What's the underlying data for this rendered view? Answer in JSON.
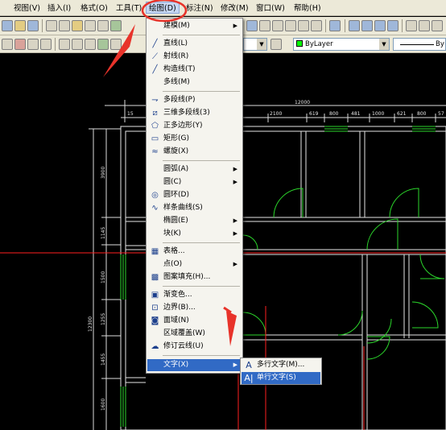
{
  "menubar": {
    "items": [
      {
        "label": "视图(V)"
      },
      {
        "label": "插入(I)"
      },
      {
        "label": "格式(O)"
      },
      {
        "label": "工具(T)"
      },
      {
        "label": "绘图(D)"
      },
      {
        "label": "标注(N)"
      },
      {
        "label": "修改(M)"
      },
      {
        "label": "窗口(W)"
      },
      {
        "label": "帮助(H)"
      }
    ],
    "active_index": 4
  },
  "toolbar": {
    "layer_color_combo": "ByLayer",
    "linetype_combo": "By"
  },
  "draw_menu": {
    "items": [
      {
        "icon": "",
        "label": "建模(M)",
        "submenu": true
      },
      {
        "icon": "line-icon",
        "label": "直线(L)",
        "submenu": false
      },
      {
        "icon": "ray-icon",
        "label": "射线(R)",
        "submenu": false
      },
      {
        "icon": "construction-line-icon",
        "label": "构造线(T)",
        "submenu": false
      },
      {
        "icon": "",
        "label": "多线(M)",
        "submenu": false
      },
      {
        "icon": "polyline-icon",
        "label": "多段线(P)",
        "submenu": false
      },
      {
        "icon": "3d-polyline-icon",
        "label": "三维多段线(3)",
        "submenu": false
      },
      {
        "icon": "polygon-icon",
        "label": "正多边形(Y)",
        "submenu": false
      },
      {
        "icon": "rectangle-icon",
        "label": "矩形(G)",
        "submenu": false
      },
      {
        "icon": "helix-icon",
        "label": "螺旋(X)",
        "submenu": false
      },
      {
        "icon": "",
        "label": "圆弧(A)",
        "submenu": true
      },
      {
        "icon": "",
        "label": "圆(C)",
        "submenu": true
      },
      {
        "icon": "donut-icon",
        "label": "圆环(D)",
        "submenu": false
      },
      {
        "icon": "spline-icon",
        "label": "样条曲线(S)",
        "submenu": false
      },
      {
        "icon": "",
        "label": "椭圆(E)",
        "submenu": true
      },
      {
        "icon": "",
        "label": "块(K)",
        "submenu": true
      },
      {
        "icon": "table-icon",
        "label": "表格...",
        "submenu": false
      },
      {
        "icon": "",
        "label": "点(O)",
        "submenu": true
      },
      {
        "icon": "hatch-icon",
        "label": "图案填充(H)...",
        "submenu": false
      },
      {
        "icon": "gradient-icon",
        "label": "渐变色...",
        "submenu": false
      },
      {
        "icon": "boundary-icon",
        "label": "边界(B)...",
        "submenu": false
      },
      {
        "icon": "region-icon",
        "label": "面域(N)",
        "submenu": false
      },
      {
        "icon": "",
        "label": "区域覆盖(W)",
        "submenu": false
      },
      {
        "icon": "revcloud-icon",
        "label": "修订云线(U)",
        "submenu": false
      },
      {
        "icon": "",
        "label": "文字(X)",
        "submenu": true,
        "highlighted": true
      }
    ]
  },
  "text_submenu": {
    "items": [
      {
        "icon": "A",
        "label": "多行文字(M)..."
      },
      {
        "icon": "A|",
        "label": "单行文字(S)",
        "highlighted": true
      }
    ]
  },
  "drawing": {
    "dimensions_top": [
      "12000",
      "2100",
      "619",
      "800",
      "481",
      "1000",
      "621",
      "800",
      "57",
      "15"
    ],
    "dimensions_left": [
      "3900",
      "1145",
      "1500",
      "1255",
      "1455",
      "1600",
      "12300"
    ]
  },
  "colors": {
    "menu_highlight": "#316ac5",
    "annotation": "#e8332a",
    "wall": "#e8e8e8",
    "door": "#2bd62b",
    "axis": "#ff2020"
  }
}
